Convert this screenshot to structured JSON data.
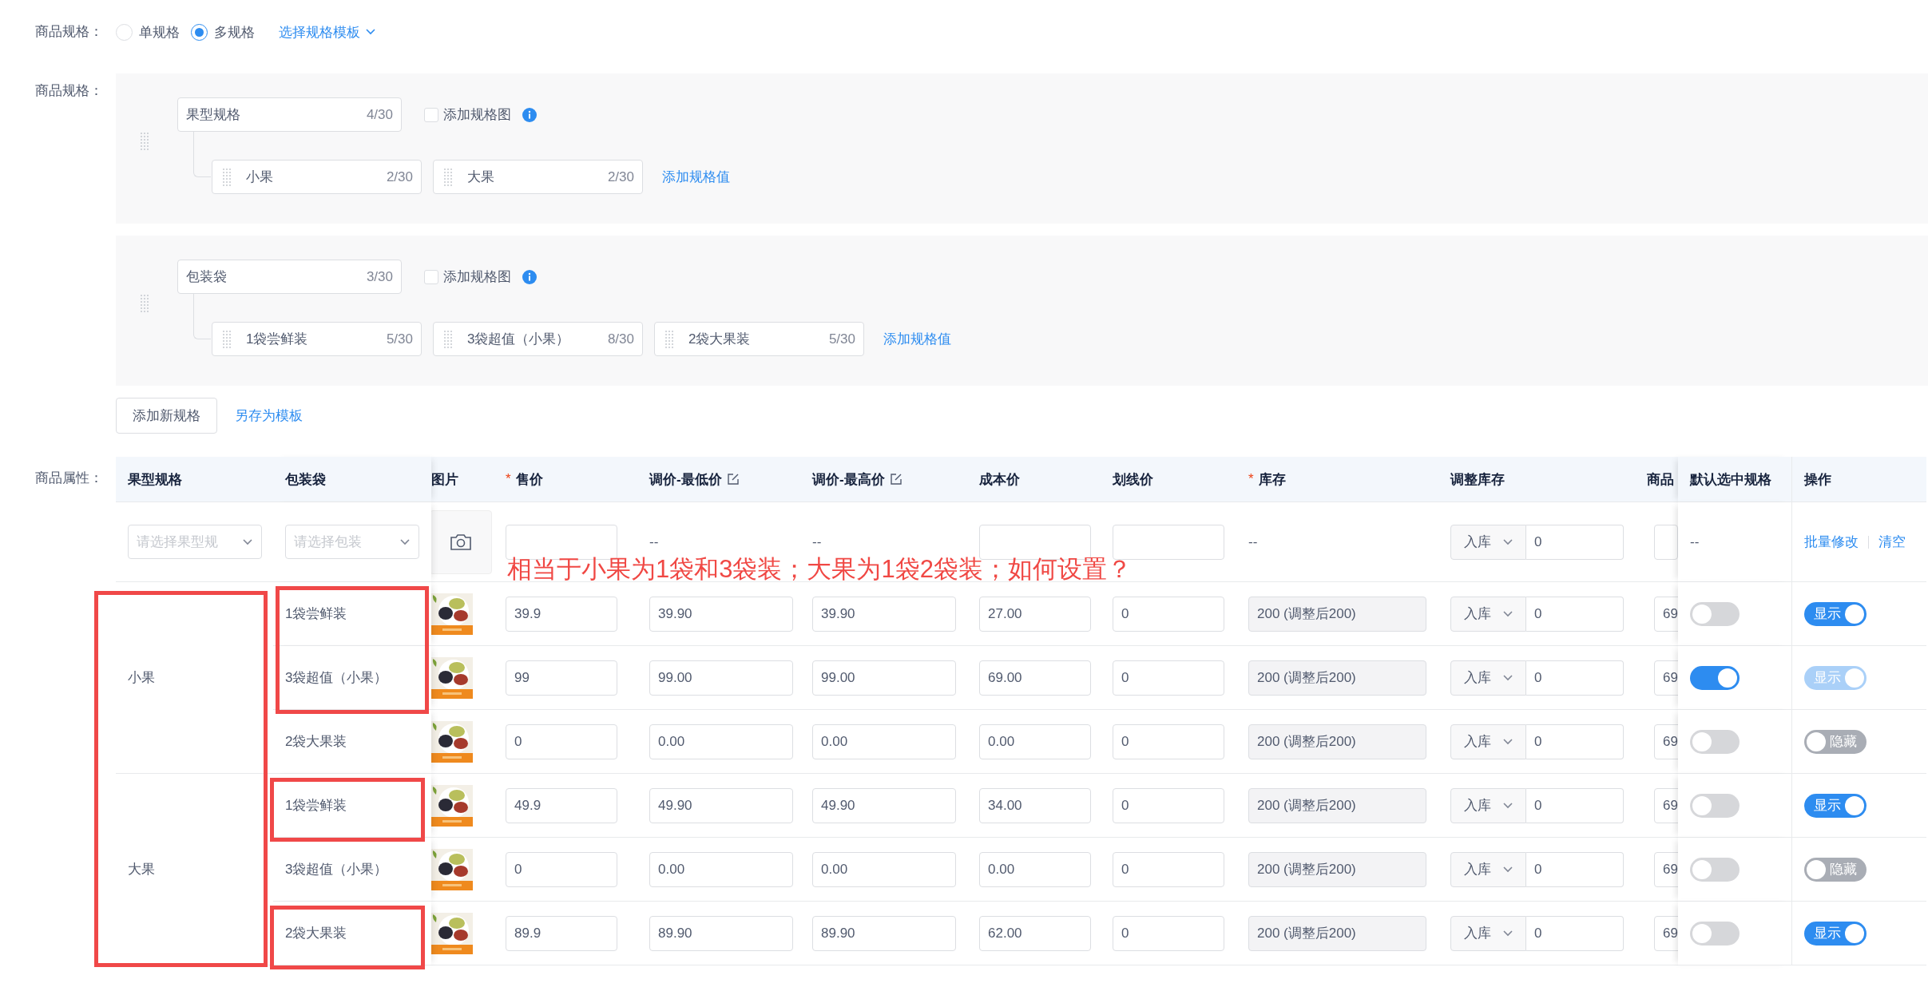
{
  "spec_type": {
    "label": "商品规格：",
    "options": [
      {
        "label": "单规格",
        "selected": false
      },
      {
        "label": "多规格",
        "selected": true
      }
    ],
    "template_link": "选择规格模板"
  },
  "specs": {
    "label": "商品规格：",
    "groups": [
      {
        "name": "果型规格",
        "count": "4/30",
        "add_image": {
          "label": "添加规格图",
          "checked": false
        },
        "values": [
          {
            "name": "小果",
            "count": "2/30"
          },
          {
            "name": "大果",
            "count": "2/30"
          }
        ],
        "add_value": "添加规格值"
      },
      {
        "name": "包装袋",
        "count": "3/30",
        "add_image": {
          "label": "添加规格图",
          "checked": false
        },
        "values": [
          {
            "name": "1袋尝鲜装",
            "count": "5/30"
          },
          {
            "name": "3袋超值（小果）",
            "count": "8/30"
          },
          {
            "name": "2袋大果装",
            "count": "5/30"
          }
        ],
        "add_value": "添加规格值"
      }
    ],
    "add_spec": "添加新规格",
    "save_template": "另存为模板"
  },
  "attributes": {
    "label": "商品属性：",
    "columns": [
      {
        "label": "果型规格"
      },
      {
        "label": "包装袋"
      },
      {
        "label": "图片"
      },
      {
        "label": "售价",
        "required_mark": "*"
      },
      {
        "label": "调价-最低价",
        "editable": true
      },
      {
        "label": "调价-最高价",
        "editable": true
      },
      {
        "label": "成本价"
      },
      {
        "label": "划线价"
      },
      {
        "label": "库存",
        "required_mark": "*"
      },
      {
        "label": "调整库存"
      },
      {
        "label": "商品"
      },
      {
        "label": "默认选中规格"
      },
      {
        "label": "操作"
      }
    ],
    "batch": {
      "fruit_placeholder": "请选择果型规",
      "pack_placeholder": "请选择包装",
      "min_price": "--",
      "max_price": "--",
      "stock": "--",
      "adjust_type": "入库",
      "adjust_qty": "0",
      "default": "--",
      "actions": [
        "批量修改",
        "清空"
      ]
    },
    "groups": [
      {
        "name": "小果",
        "rows": [
          {
            "pack": "1袋尝鲜装",
            "price": "39.9",
            "min_price": "39.90",
            "max_price": "39.90",
            "cost": "27.00",
            "line_price": "0",
            "stock": "200 (调整后200)",
            "adjust_type": "入库",
            "adjust_qty": "0",
            "code": "69",
            "default": false,
            "visibility": {
              "label": "显示",
              "on": true,
              "disabled": false
            },
            "framed": true
          },
          {
            "pack": "3袋超值（小果）",
            "price": "99",
            "min_price": "99.00",
            "max_price": "99.00",
            "cost": "69.00",
            "line_price": "0",
            "stock": "200 (调整后200)",
            "adjust_type": "入库",
            "adjust_qty": "0",
            "code": "69",
            "default": true,
            "visibility": {
              "label": "显示",
              "on": true,
              "disabled": true
            },
            "framed": true
          },
          {
            "pack": "2袋大果装",
            "price": "0",
            "min_price": "0.00",
            "max_price": "0.00",
            "cost": "0.00",
            "line_price": "0",
            "stock": "200 (调整后200)",
            "adjust_type": "入库",
            "adjust_qty": "0",
            "code": "69",
            "default": false,
            "visibility": {
              "label": "隐藏",
              "on": false,
              "disabled": false
            },
            "framed": false
          }
        ]
      },
      {
        "name": "大果",
        "rows": [
          {
            "pack": "1袋尝鲜装",
            "price": "49.9",
            "min_price": "49.90",
            "max_price": "49.90",
            "cost": "34.00",
            "line_price": "0",
            "stock": "200 (调整后200)",
            "adjust_type": "入库",
            "adjust_qty": "0",
            "code": "69",
            "default": false,
            "visibility": {
              "label": "显示",
              "on": true,
              "disabled": false
            },
            "framed": true
          },
          {
            "pack": "3袋超值（小果）",
            "price": "0",
            "min_price": "0.00",
            "max_price": "0.00",
            "cost": "0.00",
            "line_price": "0",
            "stock": "200 (调整后200)",
            "adjust_type": "入库",
            "adjust_qty": "0",
            "code": "69",
            "default": false,
            "visibility": {
              "label": "隐藏",
              "on": false,
              "disabled": false
            },
            "framed": false
          },
          {
            "pack": "2袋大果装",
            "price": "89.9",
            "min_price": "89.90",
            "max_price": "89.90",
            "cost": "62.00",
            "line_price": "0",
            "stock": "200 (调整后200)",
            "adjust_type": "入库",
            "adjust_qty": "0",
            "code": "69",
            "default": false,
            "visibility": {
              "label": "显示",
              "on": true,
              "disabled": false
            },
            "framed": true
          }
        ]
      }
    ]
  },
  "annotation": {
    "text": "相当于小果为1袋和3袋装；大果为1袋2袋装；如何设置？",
    "fruit_column_framed": true
  }
}
